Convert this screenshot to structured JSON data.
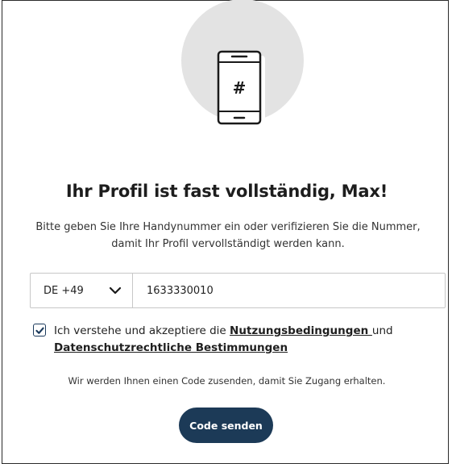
{
  "hero": {
    "icon": "phone-hash-icon",
    "icon_glyph": "#"
  },
  "title": "Ihr Profil ist fast vollständig, Max!",
  "subtitle_line1": "Bitte geben Sie Ihre Handynummer ein oder verifizieren Sie die Nummer,",
  "subtitle_line2": "damit Ihr Profil vervollständigt werden kann.",
  "phone": {
    "country_code": "DE +49",
    "number": "1633330010"
  },
  "consent": {
    "checked": true,
    "prefix": "Ich verstehe und akzeptiere die ",
    "terms_link": "Nutzungsbedingungen ",
    "middle": "und",
    "privacy_link": "Datenschutzrechtliche Bestimmungen"
  },
  "info": "Wir werden Ihnen einen Code zusenden, damit Sie Zugang erhalten.",
  "button": {
    "label": "Code senden"
  },
  "colors": {
    "primary": "#1c3a57",
    "hero_circle": "#e3e3e3",
    "border": "#c7c7c7"
  }
}
